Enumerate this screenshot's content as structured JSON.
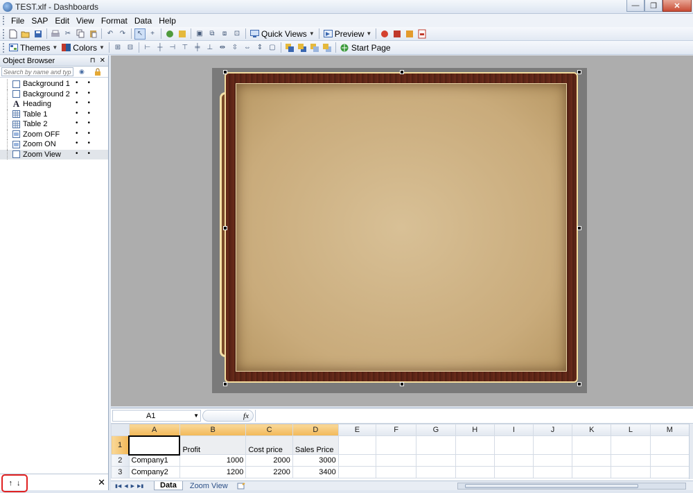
{
  "window": {
    "title": "TEST.xlf - Dashboards",
    "minimize_label": "—",
    "maximize_label": "❐",
    "close_label": "✕"
  },
  "menu": {
    "items": [
      "File",
      "SAP",
      "Edit",
      "View",
      "Format",
      "Data",
      "Help"
    ]
  },
  "toolbar1": {
    "quick_views_label": "Quick Views",
    "preview_label": "Preview"
  },
  "toolbar2": {
    "themes_label": "Themes",
    "colors_label": "Colors",
    "start_page_label": "Start Page"
  },
  "object_browser": {
    "title": "Object Browser",
    "pin_label": "⊓",
    "close_label": "✕",
    "search_placeholder": "Search by name and type",
    "items": [
      {
        "label": "Background 1",
        "icon": "square-icon"
      },
      {
        "label": "Background 2",
        "icon": "square-icon"
      },
      {
        "label": "Heading",
        "icon": "text-icon",
        "glyph": "A"
      },
      {
        "label": "Table 1",
        "icon": "table-icon"
      },
      {
        "label": "Table 2",
        "icon": "table-icon"
      },
      {
        "label": "Zoom OFF",
        "icon": "button-icon"
      },
      {
        "label": "Zoom ON",
        "icon": "button-icon"
      },
      {
        "label": "Zoom View",
        "icon": "square-icon"
      }
    ],
    "footer": {
      "up_arrow": "↑",
      "down_arrow": "↓",
      "close": "✕"
    }
  },
  "spreadsheet": {
    "name_box": "A1",
    "fx_label": "fx",
    "columns": [
      "A",
      "B",
      "C",
      "D",
      "E",
      "F",
      "G",
      "H",
      "I",
      "J",
      "K",
      "L",
      "M"
    ],
    "rows": [
      {
        "num": "1",
        "cells": [
          "",
          "Profit",
          "Cost price",
          "Sales Price",
          "",
          "",
          "",
          "",
          "",
          "",
          "",
          "",
          ""
        ]
      },
      {
        "num": "2",
        "cells": [
          "Company1",
          "1000",
          "2000",
          "3000",
          "",
          "",
          "",
          "",
          "",
          "",
          "",
          "",
          ""
        ]
      },
      {
        "num": "3",
        "cells": [
          "Company2",
          "1200",
          "2200",
          "3400",
          "",
          "",
          "",
          "",
          "",
          "",
          "",
          "",
          ""
        ]
      }
    ],
    "tabs": [
      {
        "label": "Data",
        "active": true
      },
      {
        "label": "Zoom View",
        "active": false
      }
    ]
  },
  "colors": {
    "frame_wood": "#5a2416",
    "frame_border": "#f4dd9f",
    "paper": "#d8c096",
    "canvas_bg": "#7a7a7a",
    "workspace_bg": "#adadad",
    "highlight_red": "#e02020"
  }
}
